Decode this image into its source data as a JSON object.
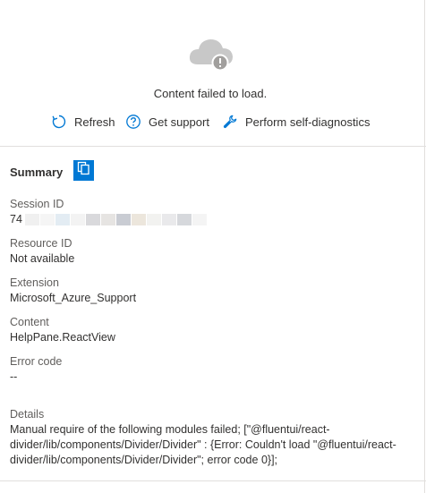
{
  "error_panel": {
    "message": "Content failed to load.",
    "actions": {
      "refresh": "Refresh",
      "support": "Get support",
      "diagnostics": "Perform self-diagnostics"
    },
    "icons": {
      "cloud": "cloud-error-icon",
      "refresh": "refresh-icon",
      "support": "help-circle-icon",
      "diagnostics": "wrench-icon",
      "copy": "copy-icon"
    },
    "accent": "#0078d4"
  },
  "summary": {
    "title": "Summary",
    "session_id": {
      "label": "Session ID",
      "value": "74"
    },
    "resource_id": {
      "label": "Resource ID",
      "value": "Not available"
    },
    "extension": {
      "label": "Extension",
      "value": "Microsoft_Azure_Support"
    },
    "content": {
      "label": "Content",
      "value": "HelpPane.ReactView"
    },
    "error_code": {
      "label": "Error code",
      "value": "--"
    },
    "details": {
      "label": "Details",
      "value": "Manual require of the following modules failed; [\"@fluentui/react-divider/lib/components/Divider/Divider\" : {Error: Couldn't load \"@fluentui/react-divider/lib/components/Divider/Divider\"; error code 0}];"
    }
  }
}
